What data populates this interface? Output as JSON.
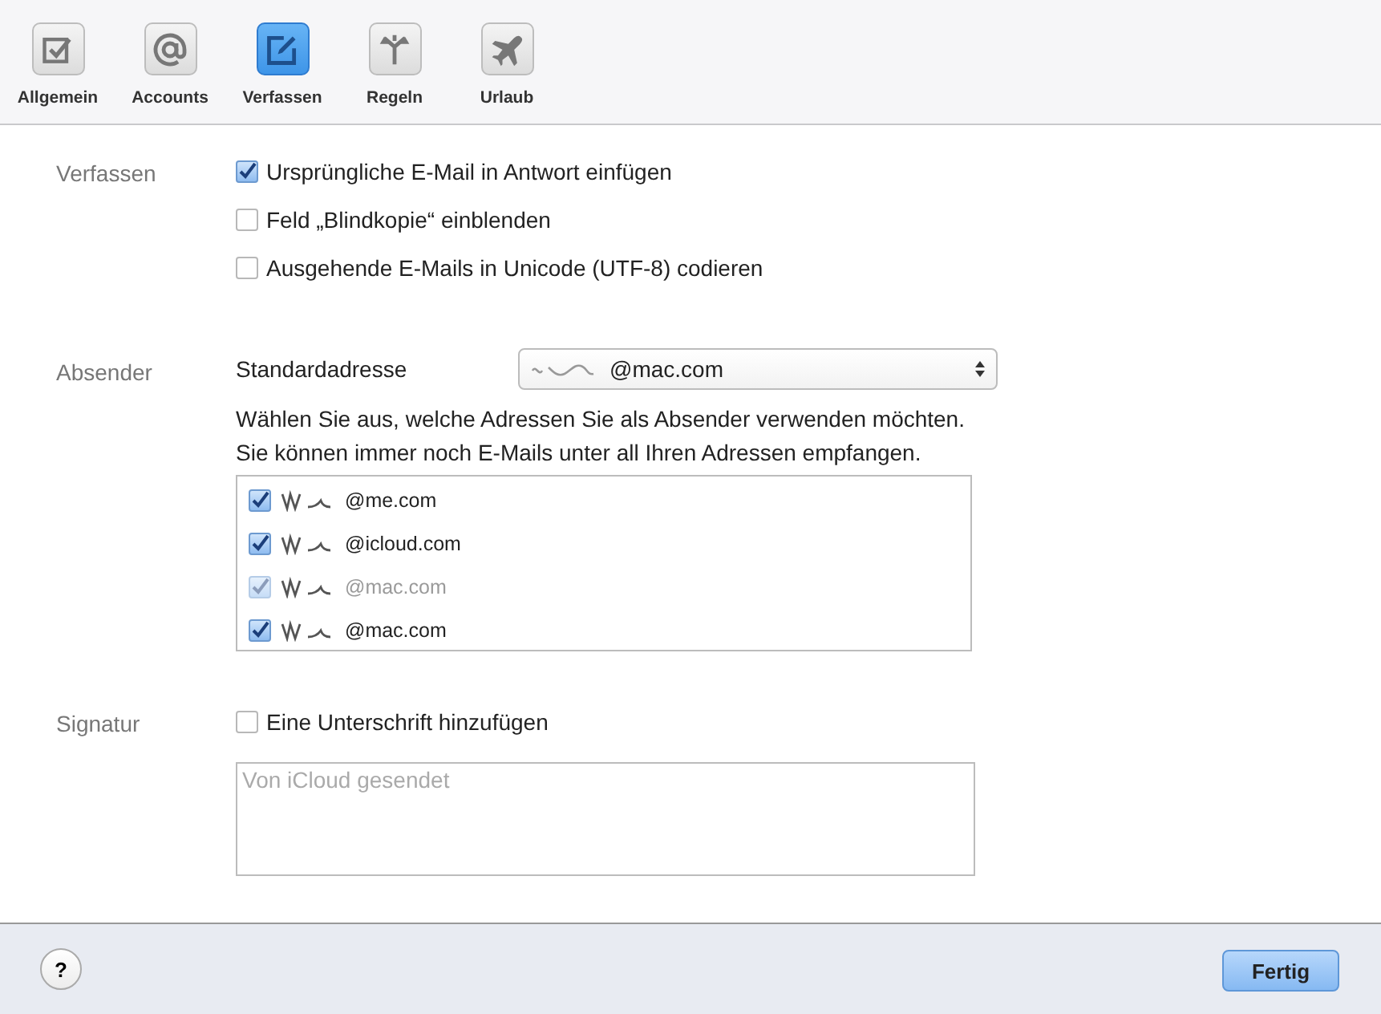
{
  "toolbar": [
    {
      "label": "Allgemein",
      "selected": false
    },
    {
      "label": "Accounts",
      "selected": false
    },
    {
      "label": "Verfassen",
      "selected": true
    },
    {
      "label": "Regeln",
      "selected": false
    },
    {
      "label": "Urlaub",
      "selected": false
    }
  ],
  "compose": {
    "label": "Verfassen",
    "options": [
      {
        "label": "Ursprüngliche E-Mail in Antwort einfügen",
        "checked": true
      },
      {
        "label": "Feld „Blindkopie“ einblenden",
        "checked": false
      },
      {
        "label": "Ausgehende E-Mails in Unicode (UTF-8) codieren",
        "checked": false
      }
    ]
  },
  "sender": {
    "label": "Absender",
    "default_label": "Standardadresse",
    "default_value": "@mac.com",
    "hint": "Wählen Sie aus, welche Adressen Sie als Absender verwenden möchten.\nSie können immer noch E-Mails unter all Ihren Adressen empfangen.",
    "addresses": [
      {
        "label": "@me.com",
        "checked": true,
        "disabled": false
      },
      {
        "label": "@icloud.com",
        "checked": true,
        "disabled": false
      },
      {
        "label": "@mac.com",
        "checked": true,
        "disabled": true
      },
      {
        "label": "@mac.com",
        "checked": true,
        "disabled": false
      }
    ]
  },
  "signature": {
    "label": "Signatur",
    "option": {
      "label": "Eine Unterschrift hinzufügen",
      "checked": false
    },
    "placeholder": "Von iCloud gesendet"
  },
  "footer": {
    "help": "?",
    "done": "Fertig"
  }
}
